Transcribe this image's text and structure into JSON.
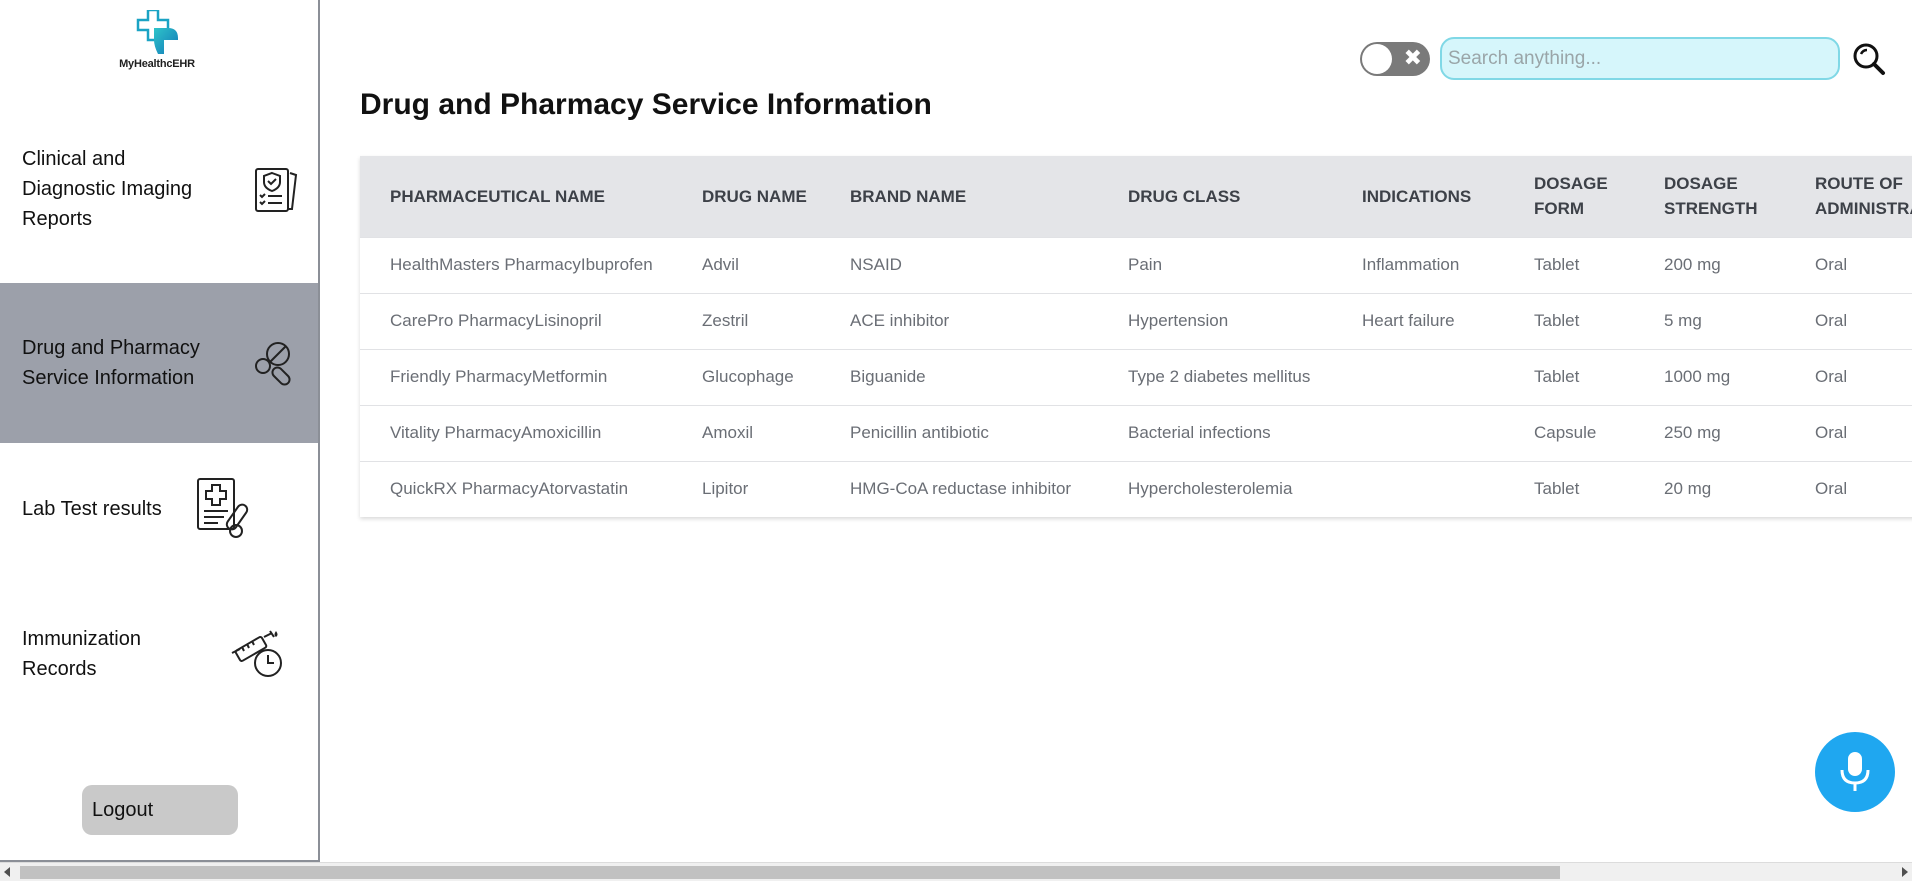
{
  "app": {
    "logo_text": "MyHealthcEHR"
  },
  "sidebar": {
    "items": [
      {
        "label": "Clinical and Diagnostic Imaging Reports",
        "icon": "clipboard-shield-icon"
      },
      {
        "label": "Drug and Pharmacy Service Information",
        "icon": "pills-icon",
        "active": true
      },
      {
        "label": "Lab Test results",
        "icon": "lab-report-icon"
      },
      {
        "label": "Immunization Records",
        "icon": "syringe-clock-icon"
      }
    ],
    "logout_label": "Logout"
  },
  "header": {
    "search_placeholder": "Search anything...",
    "toggle_symbol": "✖"
  },
  "main": {
    "title": "Drug and Pharmacy Service Information",
    "table": {
      "columns": [
        "PHARMACEUTICAL NAME",
        "DRUG NAME",
        "BRAND NAME",
        "DRUG CLASS",
        "INDICATIONS",
        "DOSAGE FORM",
        "DOSAGE STRENGTH",
        "ROUTE OF ADMINISTRATION"
      ],
      "rows": [
        [
          "HealthMasters PharmacyIbuprofen",
          "Advil",
          "NSAID",
          "Pain",
          "Inflammation",
          "Tablet",
          "200 mg",
          "Oral"
        ],
        [
          "CarePro PharmacyLisinopril",
          "Zestril",
          "ACE inhibitor",
          "Hypertension",
          "Heart failure",
          "Tablet",
          "5 mg",
          "Oral"
        ],
        [
          "Friendly PharmacyMetformin",
          "Glucophage",
          "Biguanide",
          "Type 2 diabetes mellitus",
          "",
          "Tablet",
          "1000 mg",
          "Oral"
        ],
        [
          "Vitality PharmacyAmoxicillin",
          "Amoxil",
          "Penicillin antibiotic",
          "Bacterial infections",
          "",
          "Capsule",
          "250 mg",
          "Oral"
        ],
        [
          "QuickRX PharmacyAtorvastatin",
          "Lipitor",
          "HMG-CoA reductase inhibitor",
          "Hypercholesterolemia",
          "",
          "Tablet",
          "20 mg",
          "Oral"
        ]
      ]
    }
  },
  "colors": {
    "accent": "#1fa7f0",
    "sidebar_active": "#9ca0aa",
    "search_bg": "#d6f6fb",
    "logo_teal": "#1aa3c4"
  }
}
